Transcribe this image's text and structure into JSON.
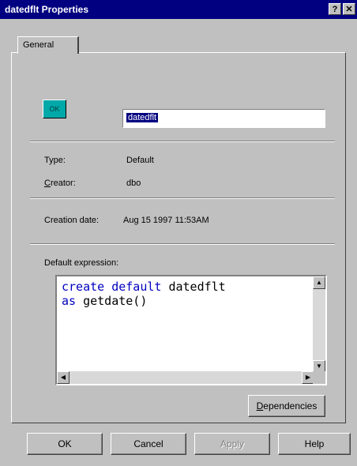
{
  "window": {
    "title": "datedflt Properties",
    "help_glyph": "?",
    "close_glyph": "✕"
  },
  "tabs": [
    {
      "label": "General"
    }
  ],
  "general": {
    "icon_text": "OK",
    "name_value": "datedflt",
    "type_label": "Type:",
    "type_value": "Default",
    "creator_label_first": "C",
    "creator_label_rest": "reator:",
    "creator_value": "dbo",
    "creation_date_label": "Creation date:",
    "creation_date_value": "Aug 15 1997 11:53AM",
    "expression_label": "Default expression:",
    "expression": {
      "line1_kw": "create default",
      "line1_rest": " datedflt",
      "line2_kw": "as",
      "line2_rest": " getdate()"
    },
    "dependencies_first": "D",
    "dependencies_rest": "ependencies"
  },
  "buttons": {
    "ok": "OK",
    "cancel": "Cancel",
    "apply": "Apply",
    "help": "Help"
  }
}
